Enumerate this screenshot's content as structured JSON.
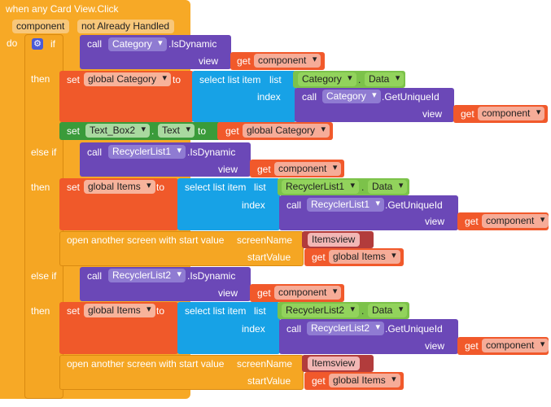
{
  "event": {
    "title": "when any Card View.Click",
    "param_component": "component",
    "param_handled": "not Already Handled"
  },
  "labels": {
    "do": "do",
    "if": "if",
    "then": "then",
    "else_if": "else if",
    "call": "call",
    "view": "view",
    "get": "get",
    "set": "set",
    "to": "to",
    "select_list_item": "select list item",
    "list": "list",
    "index": "index",
    "dot": ".",
    "open_screen": "open another screen with start value",
    "screen_name": "screenName",
    "start_value": "startValue"
  },
  "block1": {
    "if_component": "Category",
    "if_method": ".IsDynamic",
    "if_view_var": "component",
    "set_var": "global Category",
    "list_component": "Category",
    "list_prop": "Data",
    "index_component": "Category",
    "index_method": ".GetUniqueId",
    "index_view_var": "component",
    "set2_component": "Text_Box2",
    "set2_prop": "Text",
    "set2_var": "global Category"
  },
  "block2": {
    "if_component": "RecyclerList1",
    "if_method": ".IsDynamic",
    "if_view_var": "component",
    "set_var": "global Items",
    "list_component": "RecyclerList1",
    "list_prop": "Data",
    "index_component": "RecyclerList1",
    "index_method": ".GetUniqueId",
    "index_view_var": "component",
    "screen_name": "Itemsview",
    "start_value_var": "global Items"
  },
  "block3": {
    "if_component": "RecyclerList2",
    "if_method": ".IsDynamic",
    "if_view_var": "component",
    "set_var": "global Items",
    "list_component": "RecyclerList2",
    "list_prop": "Data",
    "index_component": "RecyclerList2",
    "index_method": ".GetUniqueId",
    "index_view_var": "component",
    "screen_name": "Itemsview",
    "start_value_var": "global Items"
  },
  "colors": {
    "event": "#f7a926",
    "control": "#f5a623",
    "component_method": "#6b48b7",
    "variable_set": "#f0592a",
    "list": "#17a2e6",
    "component_set": "#3a9b3a",
    "component_get": "#7cc24a",
    "text": "#b23c3c",
    "gear": "#4a5bd6"
  }
}
